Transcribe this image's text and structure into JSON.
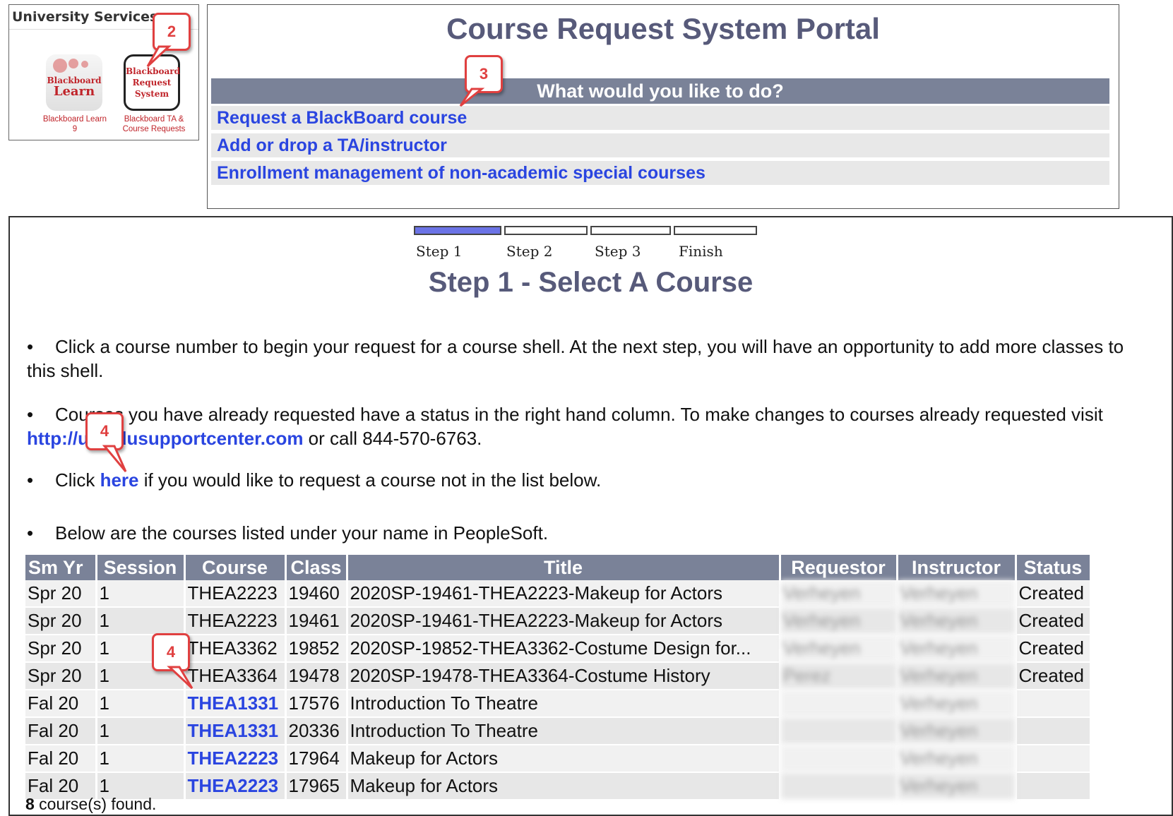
{
  "services": {
    "header": "University Services",
    "learn_tile": {
      "line1": "Blackboard",
      "line2": "Learn",
      "caption1": "Blackboard Learn",
      "caption2": "9"
    },
    "request_tile": {
      "line1": "Blackboard",
      "line2": "Request",
      "line3": "System",
      "caption1": "Blackboard TA &",
      "caption2": "Course Requests"
    }
  },
  "portal": {
    "title": "Course Request System Portal",
    "bar": "What would you like to do?",
    "links": [
      "Request a BlackBoard course",
      "Add or drop a TA/instructor",
      "Enrollment management of non-academic special courses"
    ]
  },
  "steps": {
    "labels": [
      "Step 1",
      "Step 2",
      "Step 3",
      "Finish"
    ],
    "active": 1,
    "active_color": "#6b73e6"
  },
  "step_title": "Step 1 - Select A Course",
  "bullets": {
    "b1": "Click a course number to begin your request for a course shell. At the next step, you will have an opportunity to add more classes to this shell.",
    "b2_pre": "Courses you have already requested have a status in the right hand column. To make changes to courses already requested visit ",
    "b2_link": "http://uh.edusupportcenter.com",
    "b2_post": " or call 844-570-6763.",
    "b3_pre": "Click ",
    "b3_link": "here",
    "b3_post": " if you would like to request a course not in the list below.",
    "b4": "Below are the courses listed under your name in PeopleSoft."
  },
  "table": {
    "headers": [
      "Sm Yr",
      "Session",
      "Course",
      "Class",
      "Title",
      "Requestor",
      "Instructor",
      "Status"
    ],
    "rows": [
      {
        "smyr": "Spr 20",
        "session": "1",
        "course": "THEA2223",
        "class": "19460",
        "title": "2020SP-19461-THEA2223-Makeup for Actors",
        "requestor": "Verheyen",
        "instructor": "Verheyen",
        "status": "Created",
        "link": false
      },
      {
        "smyr": "Spr 20",
        "session": "1",
        "course": "THEA2223",
        "class": "19461",
        "title": "2020SP-19461-THEA2223-Makeup for Actors",
        "requestor": "Verheyen",
        "instructor": "Verheyen",
        "status": "Created",
        "link": false
      },
      {
        "smyr": "Spr 20",
        "session": "1",
        "course": "THEA3362",
        "class": "19852",
        "title": "2020SP-19852-THEA3362-Costume Design for...",
        "requestor": "Verheyen",
        "instructor": "Verheyen",
        "status": "Created",
        "link": false
      },
      {
        "smyr": "Spr 20",
        "session": "1",
        "course": "THEA3364",
        "class": "19478",
        "title": "2020SP-19478-THEA3364-Costume History",
        "requestor": "Perez",
        "instructor": "Verheyen",
        "status": "Created",
        "link": false
      },
      {
        "smyr": "Fal 20",
        "session": "1",
        "course": "THEA1331",
        "class": "17576",
        "title": "Introduction To Theatre",
        "requestor": "",
        "instructor": "Verheyen",
        "status": "",
        "link": true
      },
      {
        "smyr": "Fal 20",
        "session": "1",
        "course": "THEA1331",
        "class": "20336",
        "title": "Introduction To Theatre",
        "requestor": "",
        "instructor": "Verheyen",
        "status": "",
        "link": true
      },
      {
        "smyr": "Fal 20",
        "session": "1",
        "course": "THEA2223",
        "class": "17964",
        "title": "Makeup for Actors",
        "requestor": "",
        "instructor": "Verheyen",
        "status": "",
        "link": true
      },
      {
        "smyr": "Fal 20",
        "session": "1",
        "course": "THEA2223",
        "class": "17965",
        "title": "Makeup for Actors",
        "requestor": "",
        "instructor": "Verheyen",
        "status": "",
        "link": true
      }
    ]
  },
  "found": {
    "count": "8",
    "text": " course(s) found."
  },
  "callouts": [
    "2",
    "3",
    "4",
    "4"
  ],
  "colors": {
    "header_bar": "#7a8298",
    "link": "#2a45e0",
    "title": "#575a7a",
    "callout": "#e04040"
  }
}
